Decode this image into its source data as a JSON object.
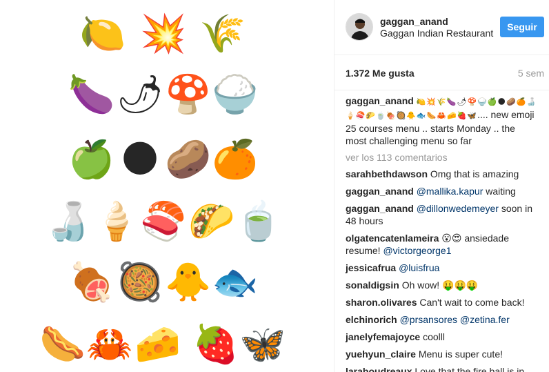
{
  "post_image": {
    "rows": [
      {
        "emojis": [
          "🍋",
          "💥",
          "🌾"
        ]
      },
      {
        "emojis": [
          "🍆",
          "🌶",
          "🍄",
          "🍚"
        ]
      },
      {
        "emojis": [
          "🍏",
          "🌑",
          "🥔",
          "🍊"
        ]
      },
      {
        "emojis": [
          "🍶",
          "🍦",
          "🍣",
          "🌮",
          "🍵"
        ]
      },
      {
        "emojis": [
          "🍖",
          "🥘",
          "🐥",
          "🐟"
        ]
      },
      {
        "emojis": [
          "🌭",
          "🦀",
          "🧀",
          "🍓",
          "🦋"
        ]
      }
    ]
  },
  "header": {
    "username": "gaggan_anand",
    "location": "Gaggan Indian Restaurant",
    "follow_label": "Seguir"
  },
  "stats": {
    "likes": "1.372 Me gusta",
    "age": "5 sem"
  },
  "caption": {
    "user": "gaggan_anand",
    "emoji_prefix": "🍋💥🌾🍆🌶🍄🍚🍏🌑🥔🍊🍶🍦🍣🌮🍵🍖🥘🐥🐟🌭🦀🧀🍓🦋",
    "text": ".... new emoji 25 courses menu .. starts Monday .. the most challenging menu so far"
  },
  "view_all_comments": "ver los 113 comentarios",
  "comments": [
    {
      "user": "sarahbethdawson",
      "pre": "",
      "mention": "",
      "text": "Omg that is amazing"
    },
    {
      "user": "gaggan_anand",
      "pre": "",
      "mention": "@mallika.kapur",
      "text": " waiting"
    },
    {
      "user": "gaggan_anand",
      "pre": "",
      "mention": "@dillonwedemeyer",
      "text": " soon in 48 hours"
    },
    {
      "user": "olgatencatenlameira",
      "pre": "😮😍 ansiedade resume! ",
      "mention": "@victorgeorge1",
      "text": ""
    },
    {
      "user": "jessicafrua",
      "pre": "",
      "mention": "@luisfrua",
      "text": ""
    },
    {
      "user": "sonaldigsin",
      "pre": "Oh wow! 🤑🤑🤑",
      "mention": "",
      "text": ""
    },
    {
      "user": "sharon.olivares",
      "pre": "Can't wait to come back!",
      "mention": "",
      "text": ""
    },
    {
      "user": "elchinorich",
      "pre": "",
      "mention": "@prsansores @zetina.fer",
      "text": ""
    },
    {
      "user": "janelyfemajoyce",
      "pre": "coolll",
      "mention": "",
      "text": ""
    },
    {
      "user": "yuehyun_claire",
      "pre": "Menu is super cute!",
      "mention": "",
      "text": ""
    },
    {
      "user": "laraboudreaux",
      "pre": "Love that the fire ball is in",
      "mention": "",
      "text": ""
    }
  ]
}
